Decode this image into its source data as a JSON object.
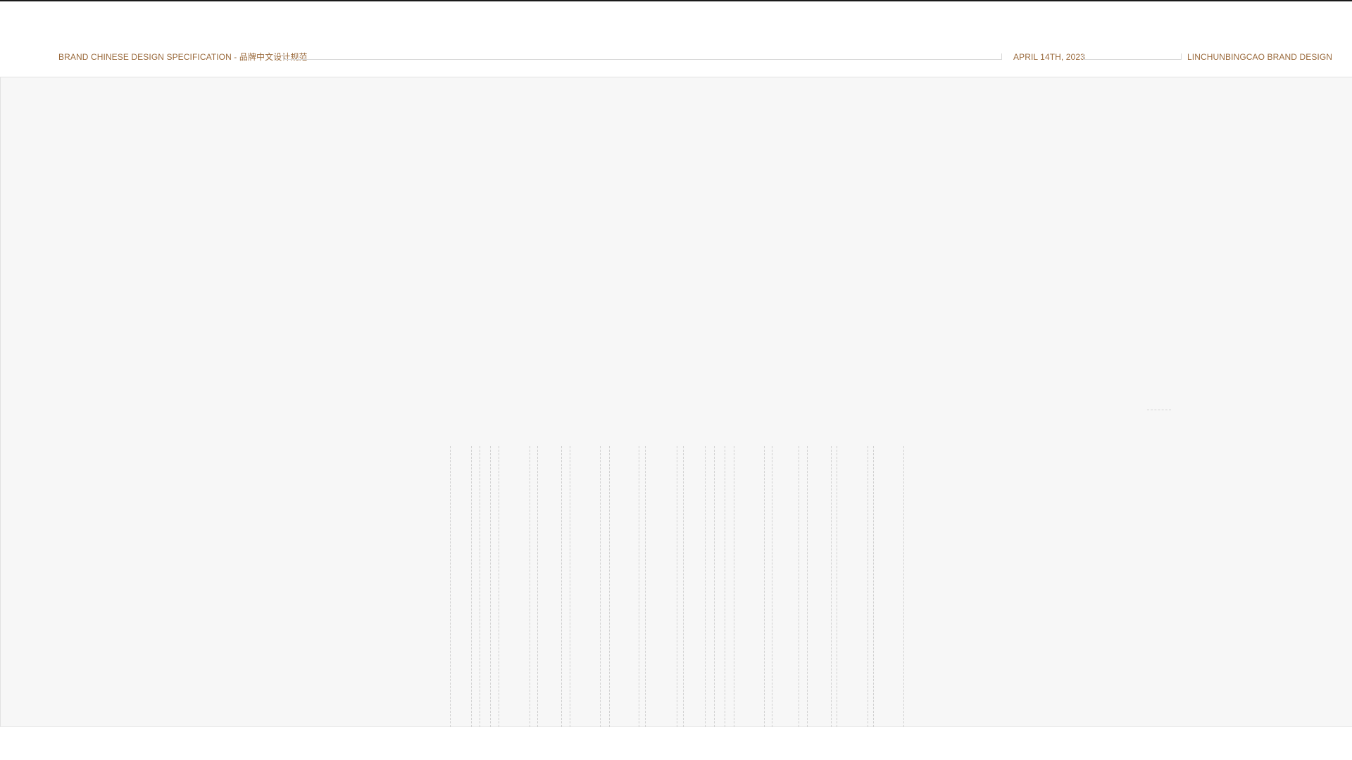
{
  "header": {
    "spec_title": "BRAND CHINESE DESIGN SPECIFICATION  -  品牌中文设计规范",
    "date": "APRIL 14TH, 2023",
    "brand": "LINCHUNBINGCAO BRAND DESIGN"
  },
  "colors": {
    "header_text": "#9a6a3c",
    "canvas_background": "#f7f7f7",
    "guide_line": "#d0d0d0",
    "top_rule": "#1a1a1a"
  }
}
